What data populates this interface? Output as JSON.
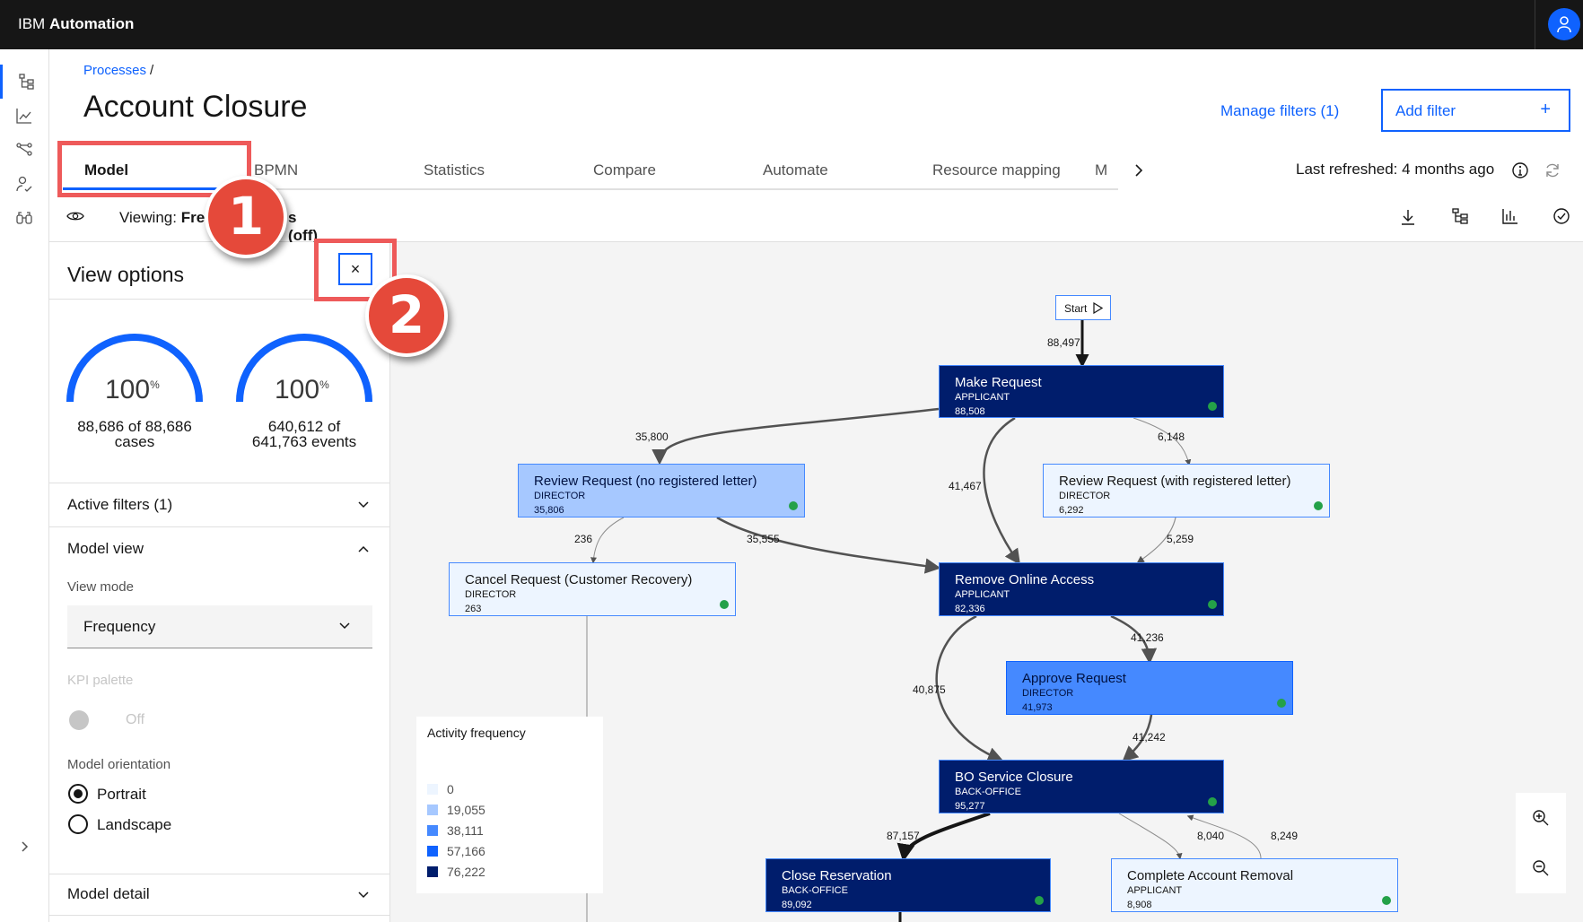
{
  "header": {
    "brand_prefix": "IBM",
    "brand_name": "Automation"
  },
  "breadcrumb": {
    "link": "Processes",
    "separator": "/"
  },
  "page_title": "Account Closure",
  "actions": {
    "manage_filters": "Manage filters (1)",
    "add_filter": "Add filter",
    "add_filter_icon": "+"
  },
  "tabs": [
    {
      "label": "Model",
      "active": true
    },
    {
      "label": "BPMN"
    },
    {
      "label": "Statistics"
    },
    {
      "label": "Compare"
    },
    {
      "label": "Automate"
    },
    {
      "label": "Resource mapping"
    },
    {
      "label": "M"
    }
  ],
  "refresh": {
    "label": "Last refreshed:",
    "value": "4 months ago"
  },
  "viewing": {
    "label": "Viewing:",
    "value_start": "Fre",
    "value_end": "s (off)"
  },
  "panel": {
    "title": "View options",
    "close": "×",
    "gauges": [
      {
        "value": "100",
        "unit": "%",
        "caption_line1": "88,686 of 88,686",
        "caption_line2": "cases",
        "fill": 1.0
      },
      {
        "value": "100",
        "unit": "%",
        "caption_line1": "640,612 of",
        "caption_line2": "641,763 events",
        "fill": 1.0
      }
    ],
    "active_filters": "Active filters (1)",
    "model_view": "Model view",
    "view_mode_label": "View mode",
    "view_mode_value": "Frequency",
    "kpi_palette_label": "KPI palette",
    "kpi_palette_toggle": "Off",
    "orientation_label": "Model orientation",
    "orientation_options": [
      "Portrait",
      "Landscape"
    ],
    "orientation_selected": "Portrait",
    "model_detail": "Model detail"
  },
  "flow": {
    "start_label": "Start",
    "nodes": [
      {
        "name": "Make Request",
        "role": "APPLICANT",
        "count": "88,508",
        "shade": "dark"
      },
      {
        "name": "Review Request (no registered letter)",
        "role": "DIRECTOR",
        "count": "35,806",
        "shade": "light"
      },
      {
        "name": "Review Request (with registered letter)",
        "role": "DIRECTOR",
        "count": "6,292",
        "shade": "pale"
      },
      {
        "name": "Cancel Request (Customer Recovery)",
        "role": "DIRECTOR",
        "count": "263",
        "shade": "pale"
      },
      {
        "name": "Remove Online Access",
        "role": "APPLICANT",
        "count": "82,336",
        "shade": "dark"
      },
      {
        "name": "Approve Request",
        "role": "DIRECTOR",
        "count": "41,973",
        "shade": "mid"
      },
      {
        "name": "BO Service Closure",
        "role": "BACK-OFFICE",
        "count": "95,277",
        "shade": "dark"
      },
      {
        "name": "Close Reservation",
        "role": "BACK-OFFICE",
        "count": "89,092",
        "shade": "dark"
      },
      {
        "name": "Complete Account Removal",
        "role": "APPLICANT",
        "count": "8,908",
        "shade": "pale"
      }
    ],
    "edge_labels": [
      "88,497",
      "35,800",
      "6,148",
      "41,467",
      "236",
      "35,555",
      "5,259",
      "41,236",
      "40,875",
      "41,242",
      "87,157",
      "8,040",
      "8,249"
    ]
  },
  "legend": {
    "title": "Activity frequency",
    "items": [
      {
        "label": "0",
        "color": "#edf5ff"
      },
      {
        "label": "19,055",
        "color": "#a6c8ff"
      },
      {
        "label": "38,111",
        "color": "#4589ff"
      },
      {
        "label": "57,166",
        "color": "#0f62fe"
      },
      {
        "label": "76,222",
        "color": "#001d6c"
      }
    ]
  },
  "callouts": [
    "1",
    "2"
  ],
  "icons": {
    "rail": [
      "process-model-icon",
      "chart-line-icon",
      "flow-icon",
      "user-activity-icon",
      "binoculars-icon"
    ],
    "toolbar": [
      "download-icon",
      "tree-view-icon",
      "chart-bar-icon",
      "checkmark-circle-icon"
    ]
  },
  "colors": {
    "accent": "#0f62fe",
    "topbar": "#161616",
    "callout": "#e5493a",
    "highlight": "#ee5a5a"
  }
}
